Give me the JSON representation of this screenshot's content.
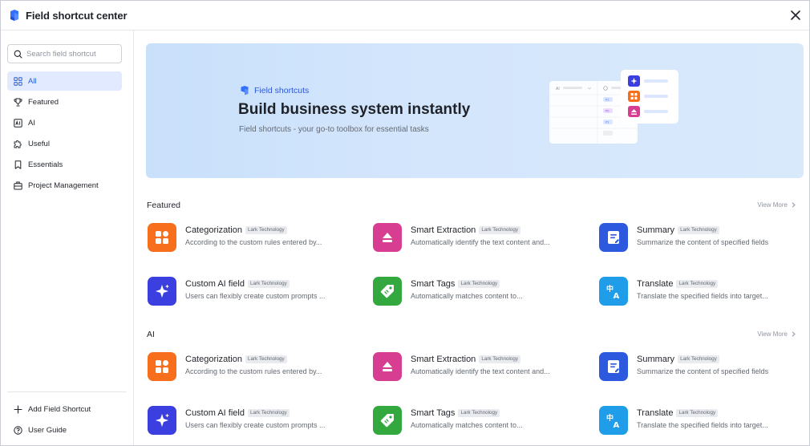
{
  "window": {
    "title": "Field shortcut center"
  },
  "search": {
    "placeholder": "Search field shortcut"
  },
  "sidebar": {
    "items": [
      {
        "label": "All",
        "icon": "grid-icon",
        "active": true
      },
      {
        "label": "Featured",
        "icon": "trophy-icon"
      },
      {
        "label": "AI",
        "icon": "ai-icon"
      },
      {
        "label": "Useful",
        "icon": "puzzle-icon"
      },
      {
        "label": "Essentials",
        "icon": "bookmark-icon"
      },
      {
        "label": "Project Management",
        "icon": "briefcase-icon"
      }
    ],
    "footer": [
      {
        "label": "Add Field Shortcut",
        "icon": "plus-icon"
      },
      {
        "label": "User Guide",
        "icon": "help-icon"
      }
    ]
  },
  "banner": {
    "tag": "Field shortcuts",
    "title": "Build business system instantly",
    "subtitle": "Field shortcuts - your go-to toolbox for essential tasks",
    "illustration": {
      "column_label": "AI",
      "chips": [
        "P1",
        "P0",
        "P1"
      ]
    }
  },
  "sections": [
    {
      "title": "Featured",
      "view_more": "View More",
      "cards": [
        {
          "name": "Categorization",
          "badge": "Lark Technology",
          "desc": "According to the custom rules entered by...",
          "icon": "categorization-icon",
          "color": "#f76e1d"
        },
        {
          "name": "Smart Extraction",
          "badge": "Lark Technology",
          "desc": "Automatically identify the text content and...",
          "icon": "extraction-icon",
          "color": "#d73d90"
        },
        {
          "name": "Summary",
          "badge": "Lark Technology",
          "desc": "Summarize the content of specified fields",
          "icon": "summary-icon",
          "color": "#2c59dd"
        },
        {
          "name": "Custom AI field",
          "badge": "Lark Technology",
          "desc": "Users can flexibly create custom prompts ...",
          "icon": "sparkle-icon",
          "color": "#3c3fe0"
        },
        {
          "name": "Smart Tags",
          "badge": "Lark Technology",
          "desc": "Automatically matches content to...",
          "icon": "tag-icon",
          "color": "#33a83f"
        },
        {
          "name": "Translate",
          "badge": "Lark Technology",
          "desc": "Translate the specified fields into target...",
          "icon": "translate-icon",
          "color": "#1f9de8"
        }
      ]
    },
    {
      "title": "AI",
      "view_more": "View More",
      "cards": [
        {
          "name": "Categorization",
          "badge": "Lark Technology",
          "desc": "According to the custom rules entered by...",
          "icon": "categorization-icon",
          "color": "#f76e1d"
        },
        {
          "name": "Smart Extraction",
          "badge": "Lark Technology",
          "desc": "Automatically identify the text content and...",
          "icon": "extraction-icon",
          "color": "#d73d90"
        },
        {
          "name": "Summary",
          "badge": "Lark Technology",
          "desc": "Summarize the content of specified fields",
          "icon": "summary-icon",
          "color": "#2c59dd"
        },
        {
          "name": "Custom AI field",
          "badge": "Lark Technology",
          "desc": "Users can flexibly create custom prompts ...",
          "icon": "sparkle-icon",
          "color": "#3c3fe0"
        },
        {
          "name": "Smart Tags",
          "badge": "Lark Technology",
          "desc": "Automatically matches content to...",
          "icon": "tag-icon",
          "color": "#33a83f"
        },
        {
          "name": "Translate",
          "badge": "Lark Technology",
          "desc": "Translate the specified fields into target...",
          "icon": "translate-icon",
          "color": "#1f9de8"
        }
      ]
    }
  ]
}
